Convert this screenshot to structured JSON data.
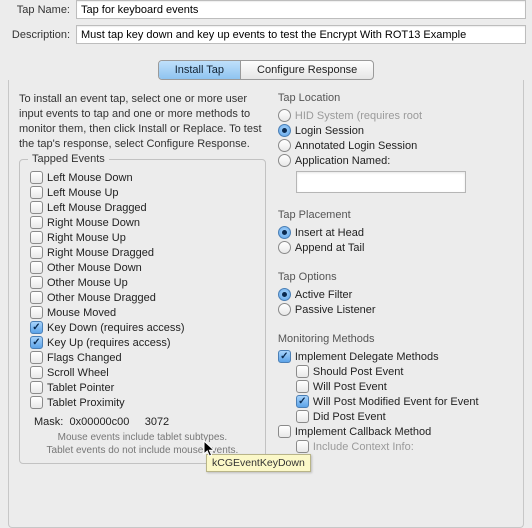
{
  "top": {
    "tap_name_label": "Tap Name:",
    "tap_name_value": "Tap for keyboard events",
    "description_label": "Description:",
    "description_value": "Must tap key down and key up events to test the Encrypt With ROT13 Example"
  },
  "tabs": {
    "install": "Install Tap",
    "configure": "Configure Response"
  },
  "intro": "To install an event tap, select one or more user input events to tap and one or more methods to monitor them, then click Install or Replace. To test the tap's response, select Configure Response.",
  "tapped_events": {
    "legend": "Tapped Events",
    "items": [
      {
        "label": "Left Mouse Down",
        "checked": false
      },
      {
        "label": "Left Mouse Up",
        "checked": false
      },
      {
        "label": "Left Mouse Dragged",
        "checked": false
      },
      {
        "label": "Right Mouse Down",
        "checked": false
      },
      {
        "label": "Right Mouse Up",
        "checked": false
      },
      {
        "label": "Right Mouse Dragged",
        "checked": false
      },
      {
        "label": "Other Mouse Down",
        "checked": false
      },
      {
        "label": "Other Mouse Up",
        "checked": false
      },
      {
        "label": "Other Mouse Dragged",
        "checked": false
      },
      {
        "label": "Mouse Moved",
        "checked": false
      },
      {
        "label": "Key Down (requires access)",
        "checked": true
      },
      {
        "label": "Key Up (requires access)",
        "checked": true
      },
      {
        "label": "Flags Changed",
        "checked": false
      },
      {
        "label": "Scroll Wheel",
        "checked": false
      },
      {
        "label": "Tablet Pointer",
        "checked": false
      },
      {
        "label": "Tablet Proximity",
        "checked": false
      }
    ],
    "mask_label": "Mask:",
    "mask_hex": "0x00000c00",
    "mask_dec": "3072",
    "footnote1": "Mouse events include tablet subtypes.",
    "footnote2": "Tablet events do not include mouse events."
  },
  "tap_location": {
    "title": "Tap Location",
    "items": [
      {
        "label": "HID System (requires root",
        "checked": false,
        "disabled": true
      },
      {
        "label": "Login Session",
        "checked": true,
        "disabled": false
      },
      {
        "label": "Annotated Login Session",
        "checked": false,
        "disabled": false
      },
      {
        "label": "Application Named:",
        "checked": false,
        "disabled": false
      }
    ],
    "appname_value": ""
  },
  "tap_placement": {
    "title": "Tap Placement",
    "items": [
      {
        "label": "Insert at Head",
        "checked": true
      },
      {
        "label": "Append at Tail",
        "checked": false
      }
    ]
  },
  "tap_options": {
    "title": "Tap Options",
    "items": [
      {
        "label": "Active Filter",
        "checked": true
      },
      {
        "label": "Passive Listener",
        "checked": false
      }
    ]
  },
  "monitoring": {
    "title": "Monitoring Methods",
    "delegate": {
      "label": "Implement Delegate Methods",
      "checked": true
    },
    "delegate_children": [
      {
        "label": "Should Post Event",
        "checked": false
      },
      {
        "label": "Will Post Event",
        "checked": false
      },
      {
        "label": "Will Post Modified Event for Event",
        "checked": true
      },
      {
        "label": "Did Post Event",
        "checked": false
      }
    ],
    "callback": {
      "label": "Implement Callback Method",
      "checked": false
    },
    "callback_children": [
      {
        "label": "Include Context Info:",
        "checked": false,
        "disabled": true
      }
    ]
  },
  "tooltip": "kCGEventKeyDown"
}
